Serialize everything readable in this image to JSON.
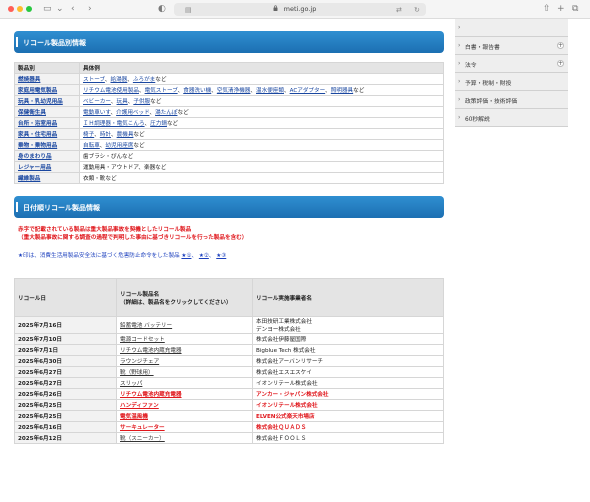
{
  "browser": {
    "url": "meti.go.jp"
  },
  "sidebar": {
    "items": [
      {
        "label": "",
        "has_plus": false
      },
      {
        "label": "白書・報告書",
        "has_plus": true
      },
      {
        "label": "法令",
        "has_plus": true
      },
      {
        "label": "予算・税制・財投",
        "has_plus": false
      },
      {
        "label": "政策評価・技術評価",
        "has_plus": false
      },
      {
        "label": "60秒解説",
        "has_plus": false
      }
    ]
  },
  "section1": {
    "title": "リコール製品別情報",
    "col_headers": [
      "製品別",
      "具体例"
    ],
    "rows": [
      {
        "category": "燃焼器具",
        "items": [
          "ストーブ",
          "給湯器",
          "ふろがま"
        ],
        "suffix": "など",
        "linked": true
      },
      {
        "category": "家庭用電気製品",
        "items": [
          "リチウム電池使用製品",
          "電気ストーブ",
          "食器洗い機",
          "空気清浄機器",
          "温水便座類",
          "ACアダプター",
          "照明器具"
        ],
        "suffix": "など",
        "linked": true
      },
      {
        "category": "玩具・乳幼児用品",
        "items": [
          "ベビーカー",
          "玩具",
          "子供服"
        ],
        "suffix": "など",
        "linked": true
      },
      {
        "category": "保健衛生具",
        "items": [
          "電動車いす",
          "介護用ベッド",
          "湯たんぽ"
        ],
        "suffix": "など",
        "linked": true
      },
      {
        "category": "台所・浴室用品",
        "items": [
          "ＩＨ調理器・電気こんろ",
          "圧力鍋"
        ],
        "suffix": "など",
        "linked": true
      },
      {
        "category": "家具・住宅用品",
        "items": [
          "椅子",
          "時計",
          "農機具"
        ],
        "suffix": "など",
        "linked": true
      },
      {
        "category": "乗物・乗物用品",
        "items": [
          "自転車",
          "幼児用座席"
        ],
        "suffix": "など",
        "linked": true
      },
      {
        "category": "身のまわり品",
        "items": [
          "歯ブラシ・ぴんなど"
        ],
        "suffix": "",
        "linked": false
      },
      {
        "category": "レジャー用品",
        "items": [
          "運動用具・アウトドア、楽器など"
        ],
        "suffix": "",
        "linked": false
      },
      {
        "category": "繊維製品",
        "items": [
          "衣類・靴など"
        ],
        "suffix": "",
        "linked": false
      }
    ]
  },
  "section2": {
    "title": "日付順リコール製品情報",
    "red_note_1": "赤字で記載されている製品は重大製品事故を契機としたリコール製品",
    "red_note_2": "（重大製品事故に関する調査の過程で判明した事由に基づきリコールを行った製品を含む）",
    "blue_note_prefix": "★印は、消費生活用製品安全法に基づく危害防止命令をした製品",
    "blue_note_links": [
      "★①",
      "★②",
      "★③"
    ],
    "col_headers": [
      "リコール日",
      "リコール製品名\n（詳細は、製品名をクリックしてください）",
      "リコール実施事業者名"
    ],
    "rows": [
      {
        "date": "2025年7月16日",
        "product": "鉛蓄電池 バッテリー",
        "company": "本田技研工業株式会社\nデンヨー株式会社",
        "red": false
      },
      {
        "date": "2025年7月10日",
        "product": "電源コードセット",
        "company": "株式会社伊藤屋国際",
        "red": false
      },
      {
        "date": "2025年7月1日",
        "product": "リチウム電池内蔵充電器",
        "company": "Bigblue Tech 株式会社",
        "red": false
      },
      {
        "date": "2025年6月30日",
        "product": "ラウンジチェア",
        "company": "株式会社アーバンリサーチ",
        "red": false
      },
      {
        "date": "2025年6月27日",
        "product": "靴（野球用）",
        "company": "株式会社エスエスケイ",
        "red": false
      },
      {
        "date": "2025年6月27日",
        "product": "スリッパ",
        "company": "イオンリテール株式会社",
        "red": false
      },
      {
        "date": "2025年6月26日",
        "product": "リチウム電池内蔵充電器",
        "company": "アンカー・ジャパン株式会社",
        "red": true
      },
      {
        "date": "2025年6月25日",
        "product": "ハンディファン",
        "company": "イオンリテール株式会社",
        "red": true
      },
      {
        "date": "2025年6月25日",
        "product": "電気温風機",
        "company": "ELVEN公式楽天市場店",
        "red": true
      },
      {
        "date": "2025年6月16日",
        "product": "サーキュレーター",
        "company": "株式会社ＱＵＡＤＳ",
        "red": true
      },
      {
        "date": "2025年6月12日",
        "product": "靴（スニーカー）",
        "company": "株式会社ＦＯＯＬＳ",
        "red": false
      }
    ]
  }
}
